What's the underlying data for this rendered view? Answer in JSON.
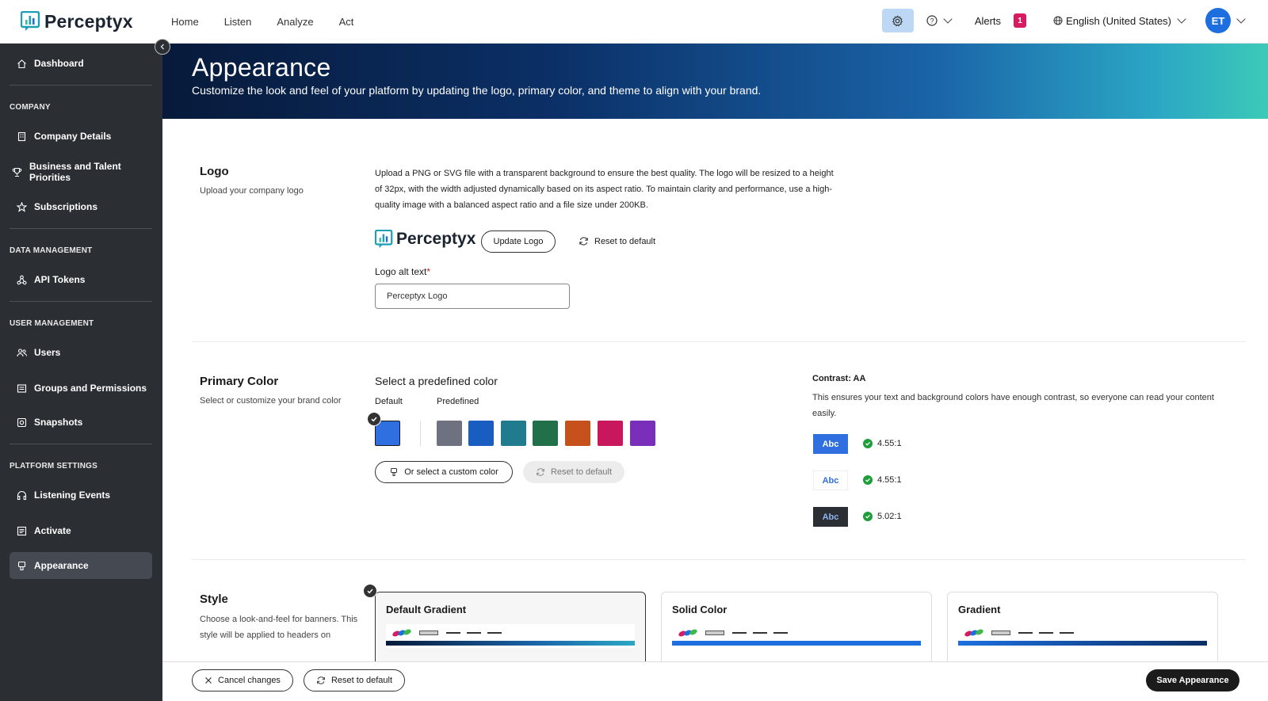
{
  "app": {
    "brand": "Perceptyx"
  },
  "nav": [
    {
      "label": "Home"
    },
    {
      "label": "Listen"
    },
    {
      "label": "Analyze"
    },
    {
      "label": "Act"
    }
  ],
  "topbar": {
    "alerts_label": "Alerts",
    "alerts_count": "1",
    "language": "English (United States)",
    "avatar_initials": "ET"
  },
  "sidebar": {
    "dashboard": "Dashboard",
    "company_section": "COMPANY",
    "company_details": "Company Details",
    "business_talent": "Business and Talent Priorities",
    "subscriptions": "Subscriptions",
    "data_section": "DATA MANAGEMENT",
    "api_tokens": "API Tokens",
    "user_section": "USER MANAGEMENT",
    "users": "Users",
    "groups": "Groups and Permissions",
    "snapshots": "Snapshots",
    "platform_section": "PLATFORM SETTINGS",
    "listening_events": "Listening Events",
    "activate": "Activate",
    "appearance": "Appearance"
  },
  "banner": {
    "title": "Appearance",
    "subtitle": "Customize the look and feel of your platform by updating the logo, primary color, and theme to align with your brand."
  },
  "logo_section": {
    "title": "Logo",
    "subtitle": "Upload your company logo",
    "description": "Upload a PNG or SVG file with a transparent background to ensure the best quality. The logo will be resized to a height of 32px, with the width adjusted dynamically based on its aspect ratio. To maintain clarity and performance, use a high-quality image with a balanced aspect ratio and a file size under 200KB.",
    "logo_text": "Perceptyx",
    "update_button": "Update Logo",
    "reset_button": "Reset to default",
    "alt_label": "Logo alt text",
    "alt_required": "*",
    "alt_value": "Perceptyx Logo"
  },
  "color_section": {
    "title": "Primary Color",
    "subtitle": "Select or customize your brand color",
    "select_title": "Select a predefined color",
    "default_label": "Default",
    "predefined_label": "Predefined",
    "default_color": "#2f6fdf",
    "predefined_colors": [
      "#6e7180",
      "#1a5dc0",
      "#217b8f",
      "#22704a",
      "#c7511d",
      "#c8175d",
      "#7a2fba"
    ],
    "custom_button": "Or select a custom color",
    "reset_button": "Reset to default",
    "contrast_title": "Contrast: AA",
    "contrast_desc": "This ensures your text and background colors have enough contrast, so everyone can read your content easily.",
    "samples": [
      {
        "text": "Abc",
        "ratio": "4.55:1"
      },
      {
        "text": "Abc",
        "ratio": "4.55:1"
      },
      {
        "text": "Abc",
        "ratio": "5.02:1"
      }
    ]
  },
  "style_section": {
    "title": "Style",
    "subtitle": "Choose a look-and-feel for banners. This style will be applied to headers on",
    "cards": [
      {
        "title": "Default Gradient"
      },
      {
        "title": "Solid Color"
      },
      {
        "title": "Gradient"
      }
    ]
  },
  "footer": {
    "cancel": "Cancel changes",
    "reset": "Reset to default",
    "save": "Save Appearance"
  }
}
